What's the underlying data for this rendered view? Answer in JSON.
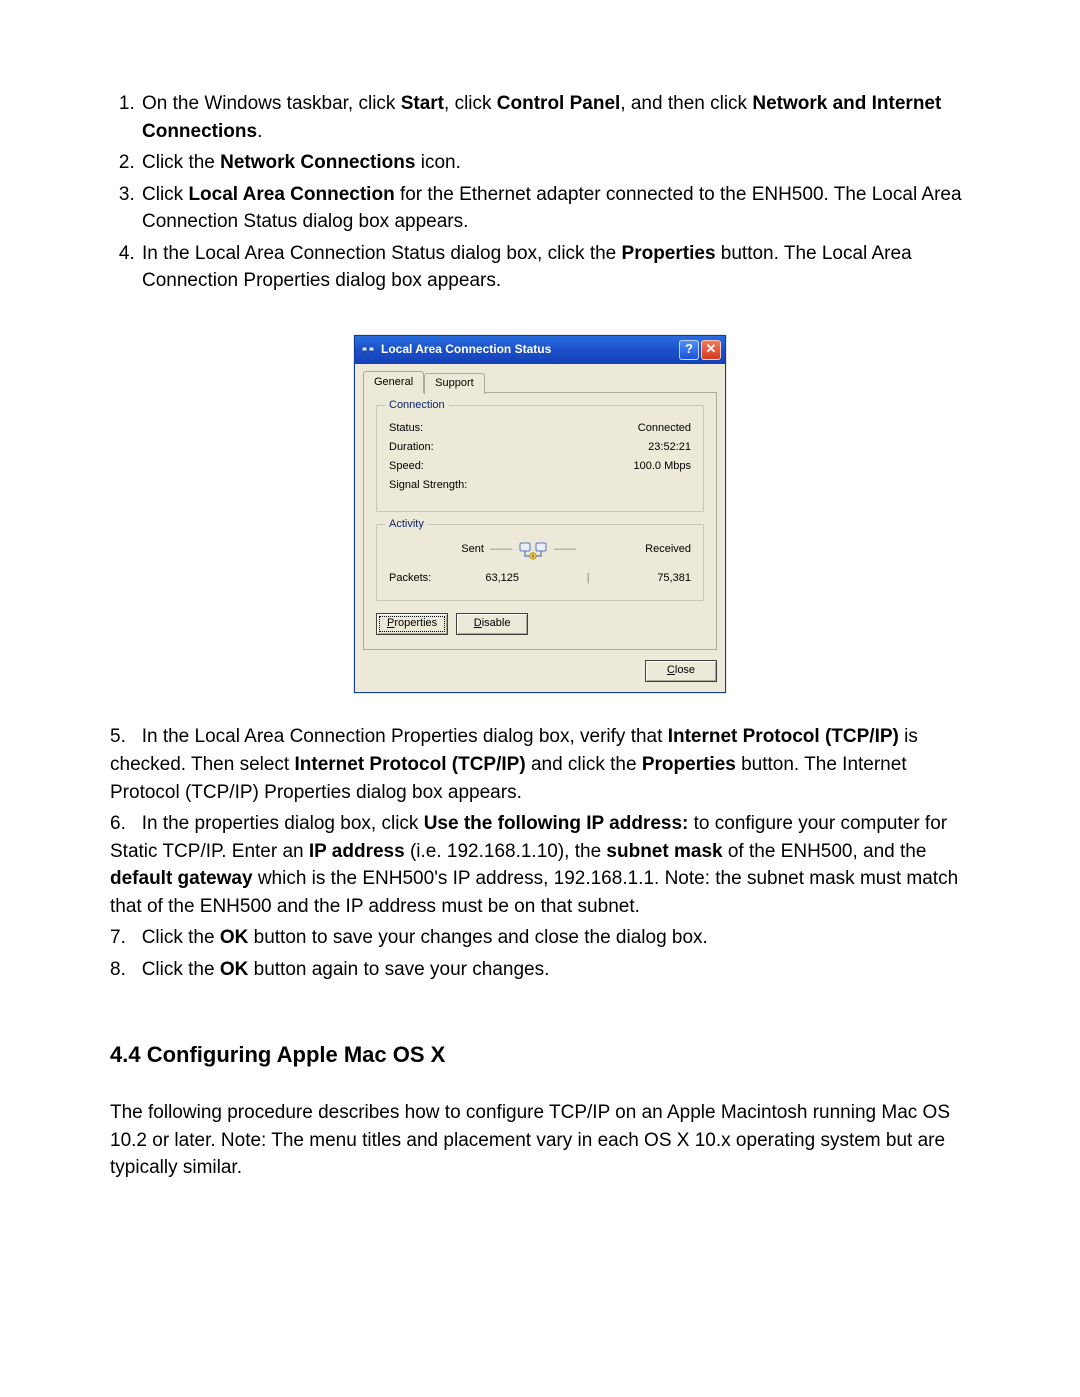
{
  "steps_upper": [
    {
      "pre": "On the Windows taskbar, click ",
      "b1": "Start",
      "mid1": ", click ",
      "b2": "Control Panel",
      "mid2": ", and then click ",
      "b3": "Network and Internet Connections",
      "post": "."
    },
    {
      "pre": "Click the ",
      "b1": "Network Connections",
      "post": " icon."
    },
    {
      "pre": "Click ",
      "b1": "Local Area Connection",
      "post": " for the Ethernet adapter connected to the ENH500. The Local Area Connection Status dialog box appears."
    },
    {
      "pre": "In the Local Area Connection Status dialog box, click the ",
      "b1": "Properties",
      "post": " button. The Local Area Connection Properties dialog box appears."
    }
  ],
  "dialog": {
    "title": "Local Area Connection Status",
    "tabs": {
      "general": "General",
      "support": "Support"
    },
    "group_connection": {
      "label": "Connection",
      "status_k": "Status:",
      "status_v": "Connected",
      "duration_k": "Duration:",
      "duration_v": "23:52:21",
      "speed_k": "Speed:",
      "speed_v": "100.0 Mbps",
      "signal_k": "Signal Strength:",
      "signal_v": ""
    },
    "group_activity": {
      "label": "Activity",
      "sent": "Sent",
      "received": "Received",
      "packets_k": "Packets:",
      "packets_sent": "63,125",
      "packets_recv": "75,381"
    },
    "buttons": {
      "properties": "Properties",
      "disable": "Disable",
      "close": "Close"
    }
  },
  "steps_lower": {
    "s5": {
      "num": "5.",
      "pre": "In the Local Area Connection Properties dialog box, verify that ",
      "b1": "Internet Protocol (TCP/IP)",
      "mid1": " is checked. Then select ",
      "b2": "Internet Protocol (TCP/IP)",
      "mid2": " and click the ",
      "b3": "Properties",
      "post": " button. The Internet Protocol (TCP/IP) Properties dialog box appears."
    },
    "s6": {
      "num": "6.",
      "pre": "In the properties dialog box, click ",
      "b1": "Use the following IP address:",
      "mid1": " to configure your computer for Static TCP/IP.    Enter an ",
      "b2": "IP address",
      "mid2": " (i.e. 192.168.1.10), the ",
      "b3": "subnet mask",
      "mid3": " of the ENH500, and the ",
      "b4": "default gateway",
      "post": " which is the ENH500's IP address, 192.168.1.1.    Note: the subnet mask must match that of the ENH500 and the IP address must be on that subnet."
    },
    "s7": {
      "num": "7.",
      "pre": "Click the ",
      "b1": "OK",
      "post": " button to save your changes and close the dialog box."
    },
    "s8": {
      "num": "8.",
      "pre": "Click the ",
      "b1": "OK",
      "post": " button again to save your changes."
    }
  },
  "section_heading": "4.4 Configuring Apple Mac OS X",
  "mac_paragraph": "The following procedure describes how to configure TCP/IP on an Apple Macintosh running Mac OS 10.2 or later.    Note: The menu titles and placement vary in each OS X 10.x operating system but are typically similar."
}
